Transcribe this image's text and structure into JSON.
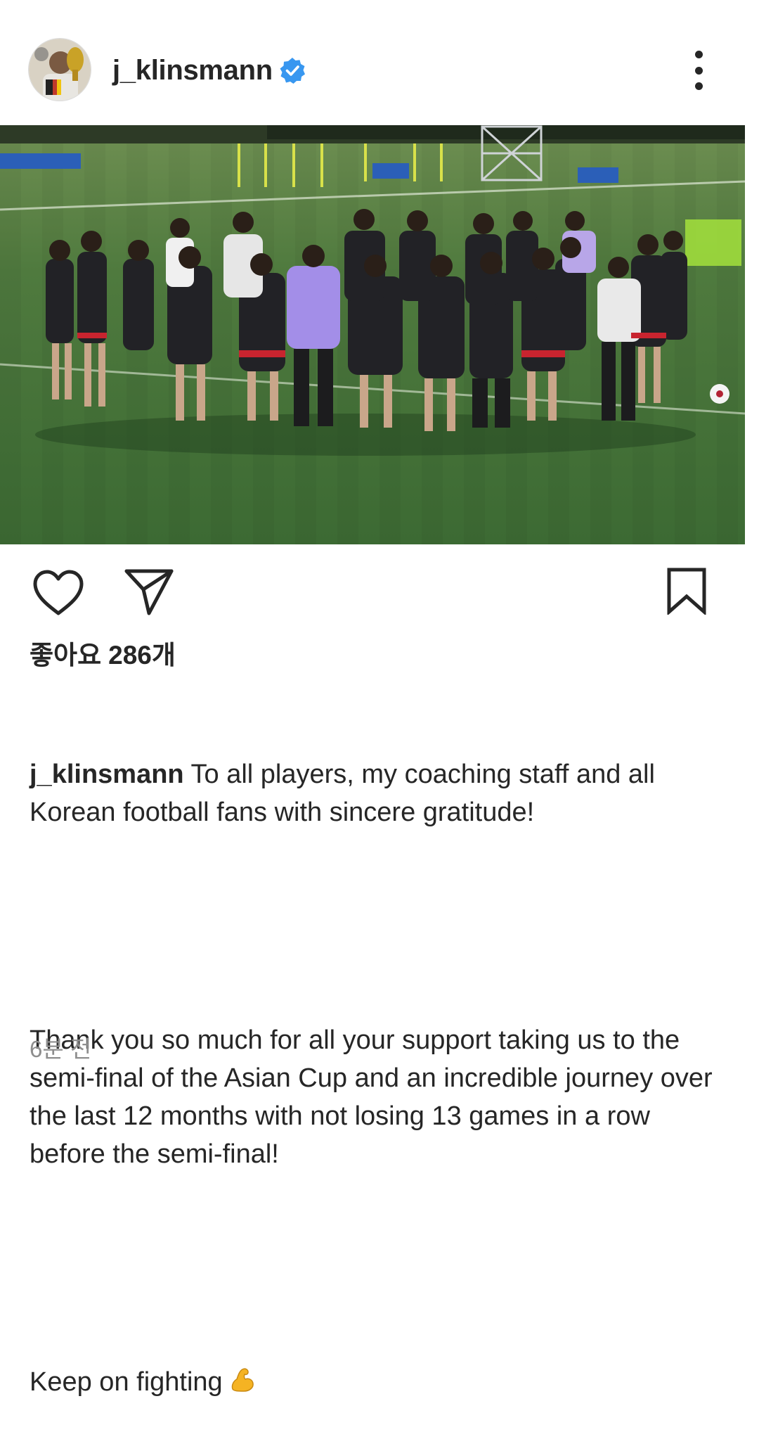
{
  "post": {
    "username": "j_klinsmann",
    "verified": true,
    "avatar_icon": "profile-photo",
    "more_icon": "more-vertical-icon"
  },
  "photo": {
    "alt_icon": "team-huddle-photo"
  },
  "actions": {
    "like_icon": "heart-icon",
    "share_icon": "send-icon",
    "save_icon": "bookmark-icon"
  },
  "likes": {
    "label": "좋아요",
    "count": "286개"
  },
  "caption": {
    "username": "j_klinsmann",
    "line1": "To all players, my coaching staff and all Korean football fans with sincere gratitude!",
    "paragraph2": "Thank you so much for all your support taking us to the semi-final of the Asian Cup and an incredible journey over the last 12 months with not losing 13 games in a row before the semi-final!",
    "paragraph3": "Keep on fighting",
    "emoji": "flexed-biceps"
  },
  "timestamp": "6분 전",
  "colors": {
    "text": "#262626",
    "muted": "#8e8e8e",
    "verified_blue": "#3897f0",
    "background": "#ffffff"
  }
}
